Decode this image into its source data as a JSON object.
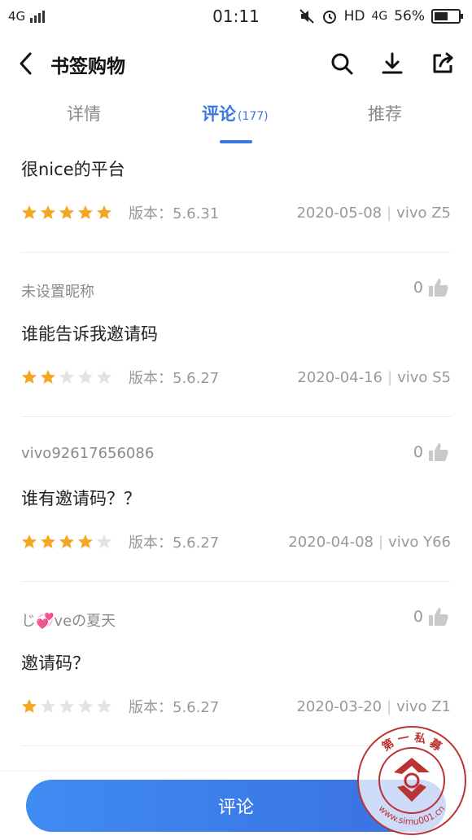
{
  "status_bar": {
    "network": "4G",
    "time": "01:11",
    "right_text": "HD",
    "network2": "4G",
    "battery_percent": "56%",
    "battery_level": 0.56
  },
  "header": {
    "title": "书签购物",
    "icons": [
      "back-arrow-icon",
      "search-icon",
      "download-icon",
      "share-icon"
    ]
  },
  "tabs": [
    {
      "label": "详情"
    },
    {
      "label": "评论",
      "count": "(177)"
    },
    {
      "label": "推荐"
    }
  ],
  "reviews": [
    {
      "content": "很nice的平台",
      "rating": 5,
      "version": "版本：5.6.31",
      "date": "2020-05-08",
      "device": "vivo Z5"
    },
    {
      "nickname": "未设置昵称",
      "likes": "0",
      "content": "谁能告诉我邀请码",
      "rating": 2,
      "version": "版本：5.6.27",
      "date": "2020-04-16",
      "device": "vivo S5"
    },
    {
      "nickname": "vivo92617656086",
      "likes": "0",
      "content": "谁有邀请码？？",
      "rating": 4,
      "version": "版本：5.6.27",
      "date": "2020-04-08",
      "device": "vivo Y66"
    },
    {
      "nickname": "じ💞veの夏天",
      "likes": "0",
      "content": "邀请码？",
      "rating": 1,
      "version": "版本：5.6.27",
      "date": "2020-03-20",
      "device": "vivo Z1"
    }
  ],
  "bottom": {
    "comment_button": "评论"
  },
  "watermark": {
    "top_text": "第 一 私 募",
    "bottom_text": "www.simu001.cn"
  },
  "colors": {
    "accent": "#3a78e0",
    "star_on": "#f5a623",
    "star_off": "#e3e3e3"
  }
}
